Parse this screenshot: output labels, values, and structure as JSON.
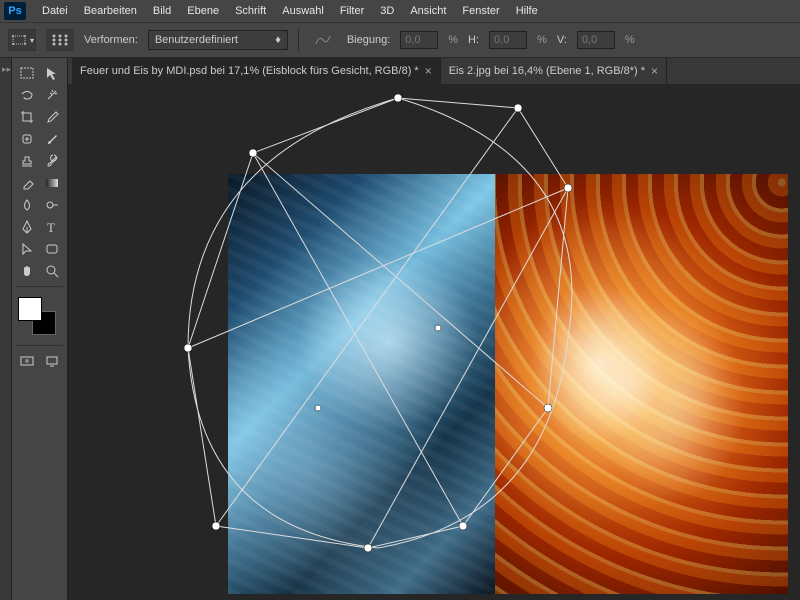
{
  "app": {
    "logo": "Ps"
  },
  "menu": {
    "items": [
      "Datei",
      "Bearbeiten",
      "Bild",
      "Ebene",
      "Schrift",
      "Auswahl",
      "Filter",
      "3D",
      "Ansicht",
      "Fenster",
      "Hilfe"
    ]
  },
  "options": {
    "transform_label": "Verformen:",
    "warp_preset": "Benutzerdefiniert",
    "bend_label": "Biegung:",
    "bend_value": "0,0",
    "pct": "%",
    "h_label": "H:",
    "h_value": "0,0",
    "v_label": "V:",
    "v_value": "0,0"
  },
  "tabs": [
    {
      "label": "Feuer und Eis by MDI.psd bei 17,1%  (Eisblock fürs Gesicht, RGB/8) *",
      "active": true
    },
    {
      "label": "Eis 2.jpg bei 16,4% (Ebene 1, RGB/8*) *",
      "active": false
    }
  ],
  "tools": {
    "left": [
      "move",
      "marquee",
      "lasso",
      "wand",
      "crop",
      "eyedropper",
      "heal",
      "brush",
      "stamp",
      "history-brush",
      "eraser",
      "gradient",
      "blur",
      "dodge",
      "pen",
      "type",
      "path-select",
      "shape",
      "hand",
      "zoom"
    ]
  },
  "swatches": {
    "fg": "#ffffff",
    "bg": "#000000"
  }
}
